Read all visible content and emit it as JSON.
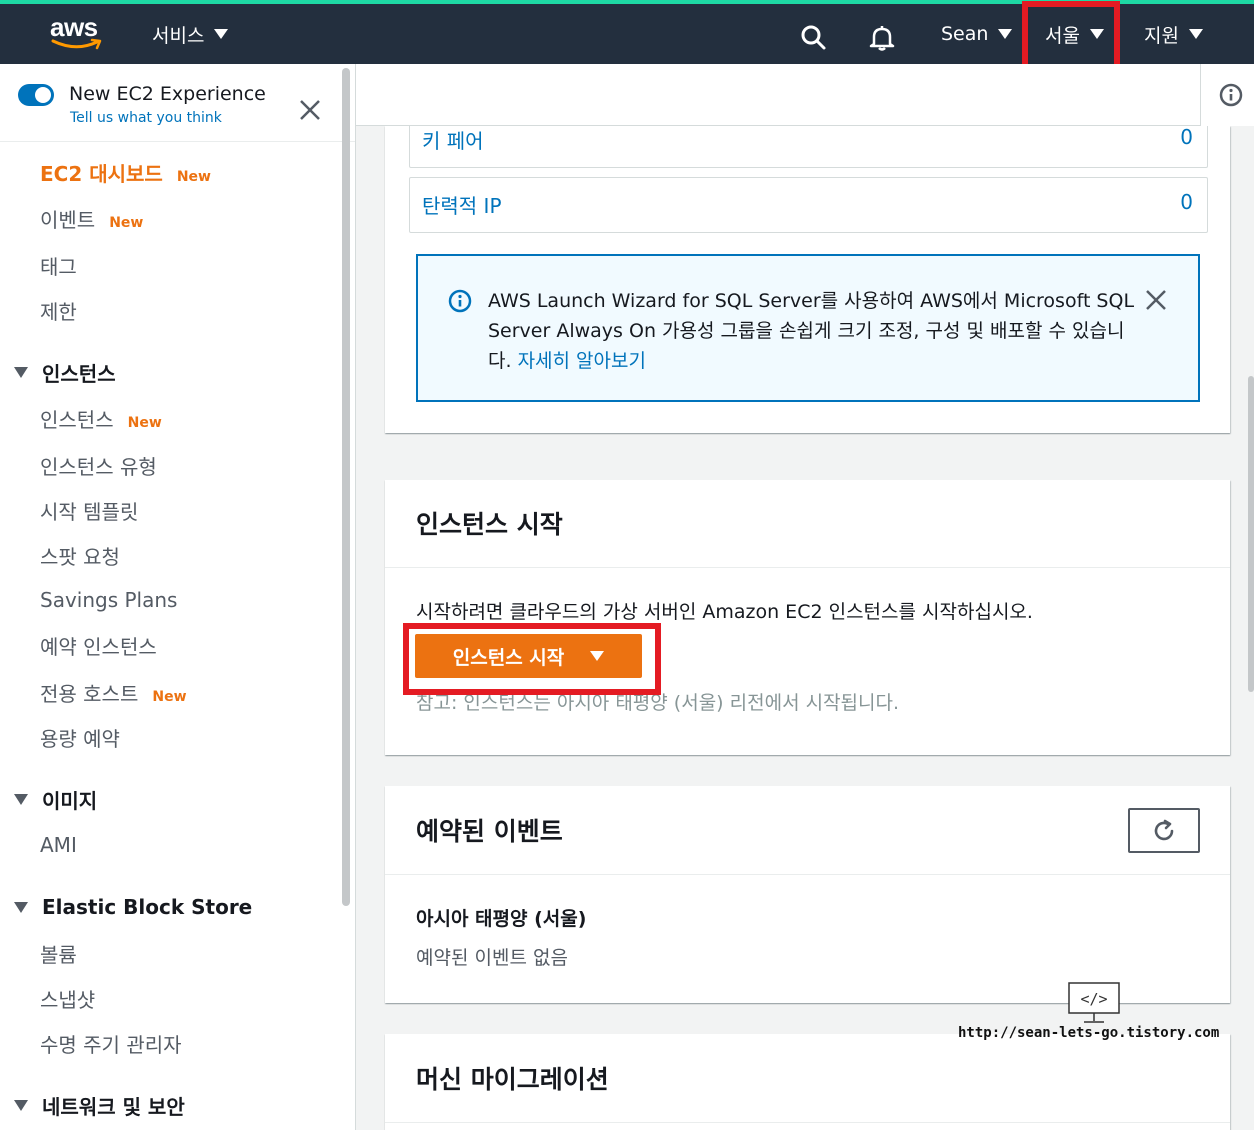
{
  "topnav": {
    "logo_text": "aws",
    "services_label": "서비스",
    "user_label": "Sean",
    "region_label": "서울",
    "support_label": "지원",
    "icons": [
      "search-icon",
      "bell-icon"
    ],
    "accent_color": "#1ed8a4",
    "highlight_color": "#e41b23"
  },
  "sidebar": {
    "experience": {
      "title": "New EC2 Experience",
      "link": "Tell us what you think"
    },
    "items": [
      {
        "label": "EC2 대시보드",
        "badge": "New"
      },
      {
        "label": "이벤트",
        "badge": "New"
      },
      {
        "label": "태그"
      },
      {
        "label": "제한"
      }
    ],
    "groups": [
      {
        "label": "인스턴스",
        "items": [
          {
            "label": "인스턴스",
            "badge": "New"
          },
          {
            "label": "인스턴스 유형"
          },
          {
            "label": "시작 템플릿"
          },
          {
            "label": "스팟 요청"
          },
          {
            "label": "Savings Plans"
          },
          {
            "label": "예약 인스턴스"
          },
          {
            "label": "전용 호스트",
            "badge": "New"
          },
          {
            "label": "용량 예약"
          }
        ]
      },
      {
        "label": "이미지",
        "items": [
          {
            "label": "AMI"
          }
        ]
      },
      {
        "label": "Elastic Block Store",
        "items": [
          {
            "label": "볼륨"
          },
          {
            "label": "스냅샷"
          },
          {
            "label": "수명 주기 관리자"
          }
        ]
      },
      {
        "label": "네트워크 및 보안"
      }
    ]
  },
  "resources": [
    {
      "label": "키 페어",
      "value": "0"
    },
    {
      "label": "탄력적 IP",
      "value": "0"
    }
  ],
  "alert": {
    "text": "AWS Launch Wizard for SQL Server를 사용하여 AWS에서 Microsoft SQL Server Always On 가용성 그룹을 손쉽게 크기 조정, 구성 및 배포할 수 있습니다. ",
    "link": "자세히 알아보기"
  },
  "launch": {
    "title": "인스턴스 시작",
    "description": "시작하려면 클라우드의 가상 서버인 Amazon EC2 인스턴스를 시작하십시오.",
    "button": "인스턴스 시작",
    "note": "참고: 인스턴스는 아시아 태평양 (서울) 리전에서 시작됩니다."
  },
  "events": {
    "title": "예약된 이벤트",
    "region": "아시아 태평양 (서울)",
    "empty": "예약된 이벤트 없음"
  },
  "migration": {
    "title": "머신 마이그레이션"
  },
  "watermark": {
    "text": "http://sean-lets-go.tistory.com"
  }
}
